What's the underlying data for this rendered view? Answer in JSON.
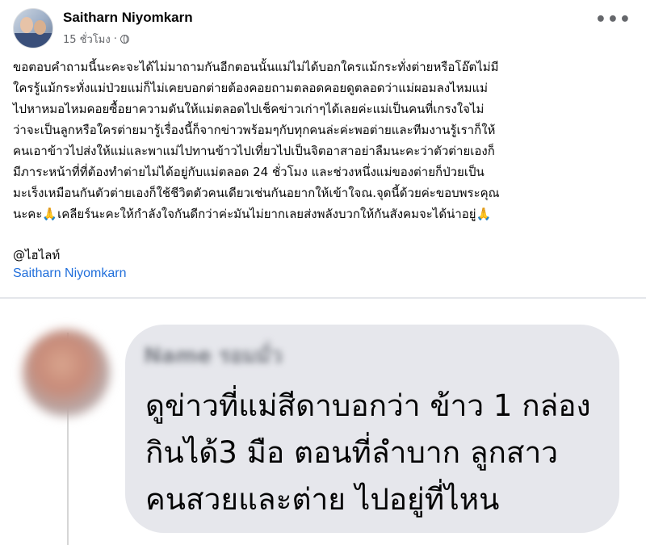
{
  "post": {
    "author": "Saitharn Niyomkarn",
    "time": "15 ชั่วโมง",
    "separator": "·",
    "more_icon": "•••",
    "body": "ขอตอบคำถามนี้นะคะจะได้ไม่มาถามกันอีกตอนนั้นแม่ไม่ได้บอกใครแม้กระทั่งต่ายหรือโอ๊ตไม่มี\nใครรู้แม้กระทั่งแม่ป่วยแม่ก็ไม่เคยบอกต่ายต้องคอยถามตลอดคอยดูตลอดว่าแม่ผอมลงไหมแม่\nไปหาหมอไหมคอยซื้อยาความดันให้แม่ตลอดไปเช็คข่าวเก่าๆได้เลยค่ะแม่เป็นคนที่เกรงใจไม่\nว่าจะเป็นลูกหรือใครต่ายมารู้เรื่องนี้ก็จากข่าวพร้อมๆกับทุกคนล่ะค่ะพอต่ายและทีมงานรู้เราก็ให้\nคนเอาข้าวไปส่งให้แม่และพาแม่ไปทานข้าวไปเที่ยวไปเป็นจิตอาสาอย่าลืมนะคะว่าตัวต่ายเองก็\nมีภาระหน้าที่ที่ต้องทำต่ายไม่ได้อยู่กับแม่ตลอด 24 ชั่วโมง และช่วงหนึ่งแม่ของต่ายก็ป่วยเป็น\nมะเร็งเหมือนกันตัวต่ายเองก็ใช้ชีวิตตัวคนเดียวเช่นกันอยากให้เข้าใจณ.จุดนี้ด้วยค่ะขอบพระคุณ\nนะคะ🙏เคลียร์นะคะให้กำลังใจกันดีกว่าค่ะมันไม่ยากเลยส่งพลังบวกให้กันสังคมจะได้น่าอยู่🙏",
    "tag": "@ไฮไลท์",
    "name_link": "Saitharn Niyomkarn"
  },
  "comment": {
    "author_blurred": "Name รอมมั่ว",
    "text": "ดูข่าวที่แม่สีดาบอกว่า ข้าว 1 กล่อง\nกินได้3 มือ ตอนที่ลำบาก ลูกสาว\nคนสวยและต่าย ไปอยู่ที่ไหน"
  },
  "colors": {
    "link": "#216fdb",
    "bubble": "#e6e7ec",
    "meta": "#65676b"
  }
}
